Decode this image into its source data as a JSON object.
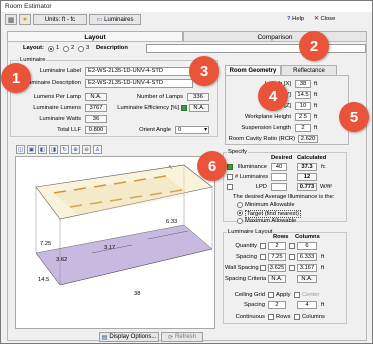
{
  "window": {
    "title": "Room Estimator"
  },
  "toolbar": {
    "units_label": "Units: ft - fc",
    "luminaires_label": "Luminaires",
    "help_label": "Help",
    "close_label": "Close"
  },
  "tabs": {
    "layout": "Layout",
    "comparison": "Comparison"
  },
  "layout_row": {
    "label": "Layout:",
    "options": [
      "1",
      "2",
      "3"
    ],
    "selected": "1",
    "description_label": "Description",
    "description_value": ""
  },
  "luminaire": {
    "group_title": "Luminaire",
    "label_label": "Luminaire Label",
    "label_value": "E2-WS-2L35-1D-UNV-4-STD",
    "desc_label": "Luminaire Description",
    "desc_value": "E2-WS-2L35-1D-UNV-4-STD",
    "lumens_per_lamp_label": "Lumens Per Lamp",
    "lumens_per_lamp_value": "N.A.",
    "luminaire_lumens_label": "Luminaire Lumens",
    "luminaire_lumens_value": "3767",
    "luminaire_watts_label": "Luminaire Watts",
    "luminaire_watts_value": "36",
    "total_llf_label": "Total LLF",
    "total_llf_value": "0.800",
    "num_lamps_label": "Number of Lamps",
    "num_lamps_value": "336",
    "efficiency_label": "Luminaire Efficiency [%]",
    "efficiency_value": "N.A.",
    "orient_angle_label": "Orient Angle",
    "orient_angle_value": "0"
  },
  "subtabs": {
    "room_geometry": "Room Geometry",
    "reflectance": "Reflectance"
  },
  "room": {
    "length_label": "Length [X]",
    "length_value": "38",
    "width_label": "Width [Y]",
    "width_value": "14.5",
    "height_label": "Height [Z]",
    "height_value": "10",
    "workplane_label": "Workplane Height",
    "workplane_value": "2.5",
    "suspension_label": "Suspension Length",
    "suspension_value": "2",
    "unit": "ft",
    "rcr_label": "Room Cavity Ratio (RCR)",
    "rcr_value": "2.620"
  },
  "specify": {
    "group_title": "Specify",
    "desired_header": "Desired",
    "calculated_header": "Calculated",
    "illuminance_label": "Illuminance",
    "illuminance_desired": "40",
    "illuminance_calc": "37.3",
    "illuminance_unit": "fc",
    "luminaires_label": "# Luminaires",
    "luminaires_calc": "12",
    "lpd_label": "LPD",
    "lpd_calc": "0.773",
    "lpd_unit": "W/ft²",
    "note": "The desired Average Illuminance is the:",
    "options": [
      "Minimum Allowable",
      "Target (find nearest)",
      "Maximum Allowable"
    ],
    "selected": "Target (find nearest)"
  },
  "luminaire_layout": {
    "group_title": "Luminaire Layout",
    "rows_header": "Rows",
    "columns_header": "Columns",
    "quantity_label": "Quantity",
    "quantity_rows": "2",
    "quantity_cols": "6",
    "spacing_label": "Spacing",
    "spacing_rows": "7.25",
    "spacing_cols": "6.333",
    "spacing_unit": "ft",
    "wall_spacing_label": "Wall Spacing",
    "wall_rows": "3.625",
    "wall_cols": "3.167",
    "wall_unit": "ft",
    "criteria_label": "Spacing Criteria",
    "criteria_rows": "N.A.",
    "criteria_cols": "N.A.",
    "ceiling_grid_label": "Ceiling Grid",
    "apply_label": "Apply",
    "center_label": "Center",
    "spacing2_label": "Spacing",
    "spacing2_x": "2",
    "spacing2_y": "4",
    "spacing2_unit": "ft",
    "continuous_label": "Continuous",
    "cont_rows": "Rows",
    "cont_cols": "Columns"
  },
  "view3d": {
    "dims": {
      "length": "38",
      "width": "14.5",
      "height": "10",
      "spacing_cols": "6.33",
      "spacing_rows": "7.25",
      "wall_cols": "3.17",
      "wall_rows": "3.62"
    },
    "display_options_label": "Display Options...",
    "refresh_label": "Refresh"
  },
  "callouts": [
    "1",
    "2",
    "3",
    "4",
    "5",
    "6"
  ],
  "colors": {
    "callout": "#e8533a",
    "floor": "#c7b9e0",
    "ceiling": "#f5e9c0",
    "fixture": "#c98a2a"
  }
}
